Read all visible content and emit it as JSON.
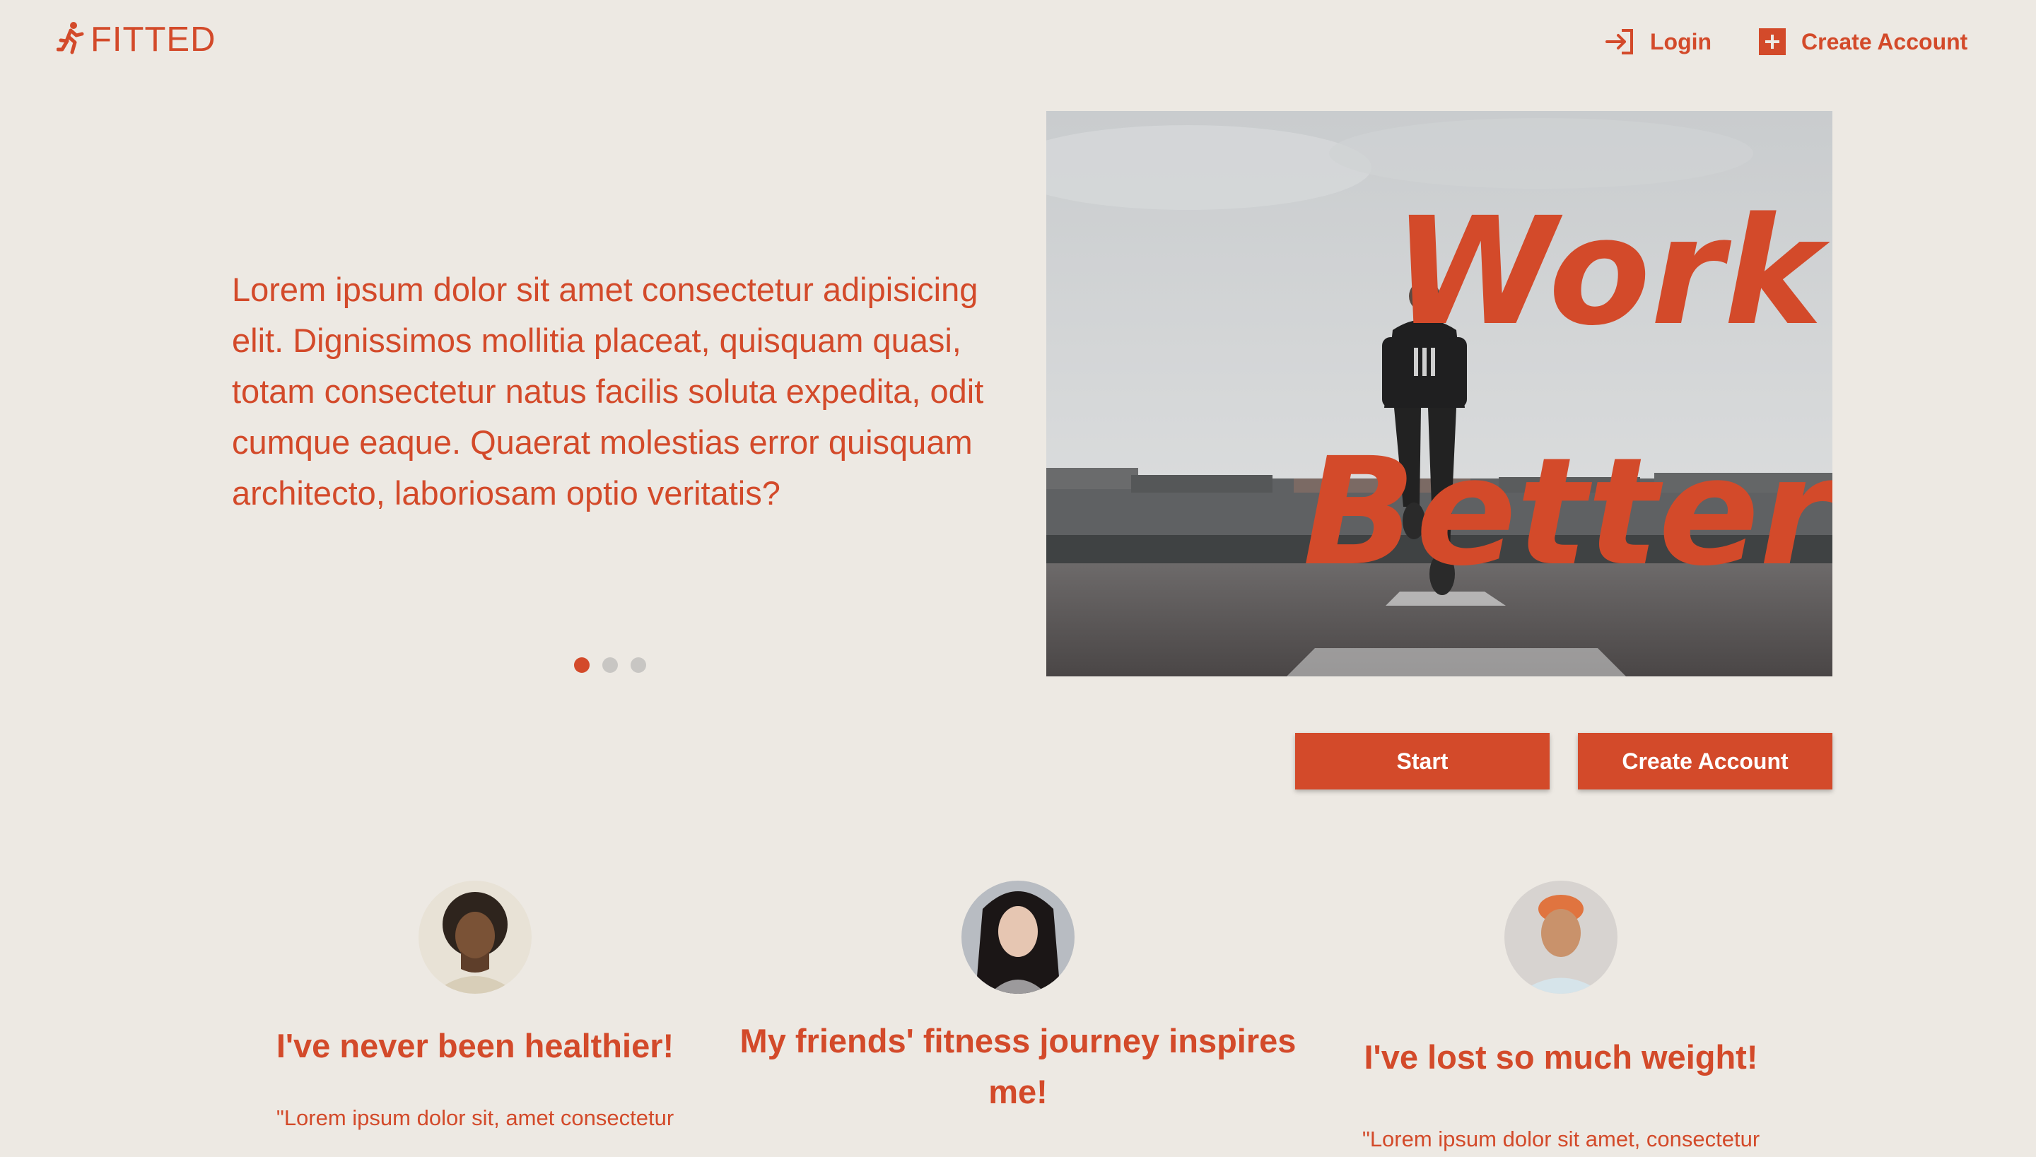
{
  "header": {
    "logo_icon": "running-person-icon",
    "logo_text": "FITTED",
    "login_label": "Login",
    "login_icon": "login-arrow-icon",
    "create_account_label": "Create Account",
    "create_account_icon": "plus-square-icon"
  },
  "hero": {
    "text": "Lorem ipsum dolor sit amet consectetur adipisicing elit. Dignissimos mollitia placeat, quisquam quasi, totam consectetur natus facilis soluta expedita, odit cumque eaque. Quaerat molestias error quisquam architecto, laboriosam optio veritatis?",
    "carousel": {
      "total": 3,
      "active": 1
    },
    "image_words": [
      "Work",
      "Better"
    ]
  },
  "actions": {
    "start_label": "Start",
    "create_account_label": "Create Account"
  },
  "testimonials": [
    {
      "title": "I've never been healthier!",
      "quote": "\"Lorem ipsum dolor sit, amet consectetur"
    },
    {
      "title": "My friends' fitness journey inspires me!",
      "quote": ""
    },
    {
      "title": "I've lost so much weight!",
      "quote": "\"Lorem ipsum dolor sit amet, consectetur"
    }
  ],
  "colors": {
    "accent": "#d34a2a",
    "background": "#ede9e3",
    "dot_inactive": "#c8c6c3"
  }
}
